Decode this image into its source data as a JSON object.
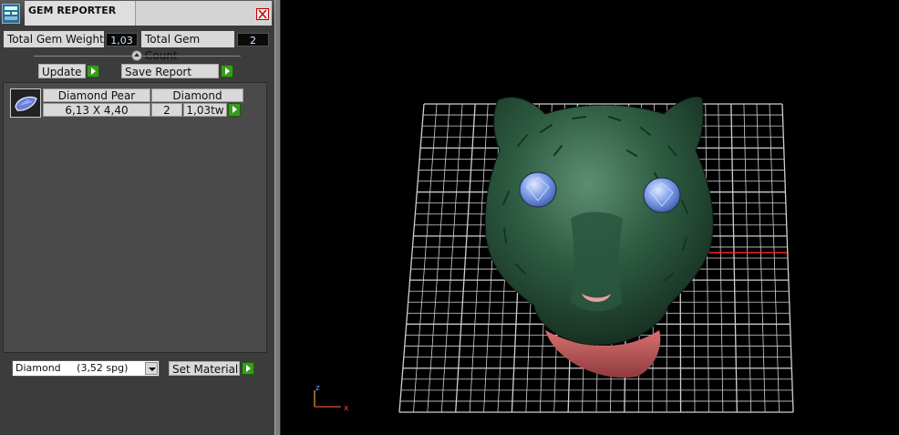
{
  "title": "GEM REPORTER",
  "stats": {
    "total_weight_label": "Total Gem Weight",
    "total_weight_value": "1,03",
    "total_count_label": "Total Gem Count",
    "total_count_value": "2"
  },
  "buttons": {
    "update": "Update",
    "save_report": "Save Report",
    "set_material": "Set Material"
  },
  "gem_row": {
    "name": "Diamond Pear",
    "material": "Diamond",
    "size": "6,13 X 4,40",
    "count": "2",
    "weight": "1,03tw"
  },
  "material_select": {
    "selected": "Diamond     (3,52 spg)"
  },
  "viewport": {
    "axis_labels": {
      "z": "z",
      "x": "x"
    },
    "colors": {
      "skin": "#2c5a40",
      "eyes": "#7f9fe8",
      "mouth": "#c0565a",
      "grid": "#cfcfcf",
      "axis_x": "#ff2020"
    }
  }
}
